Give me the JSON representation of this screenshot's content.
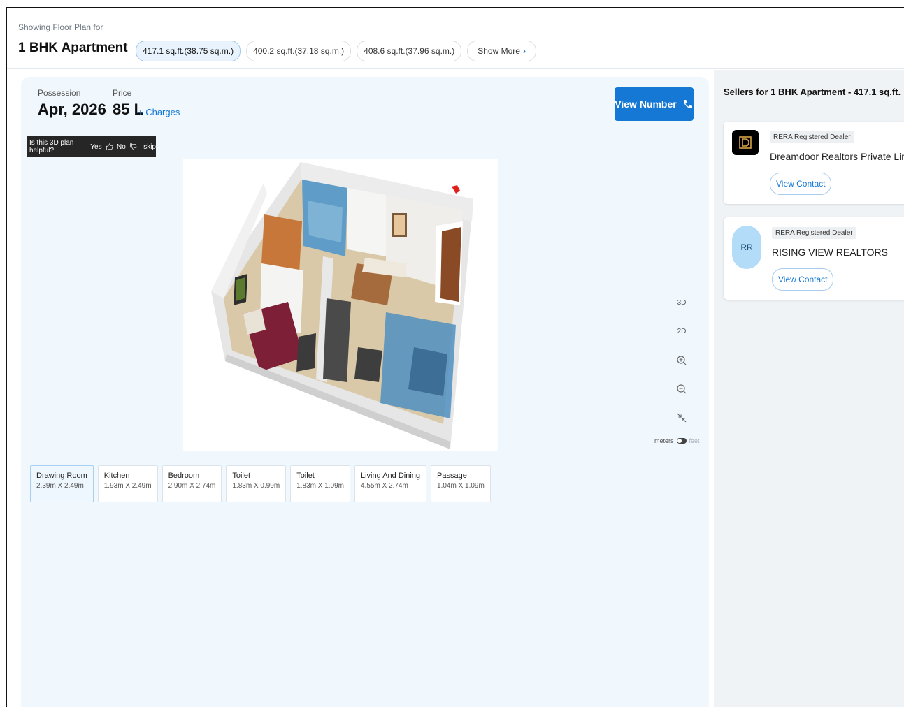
{
  "header": {
    "showing_label": "Showing Floor Plan for",
    "configuration": "1 BHK Apartment",
    "size_options": [
      "417.1 sq.ft.(38.75 sq.m.)",
      "400.2 sq.ft.(37.18 sq.m.)",
      "408.6 sq.ft.(37.96 sq.m.)"
    ],
    "show_more_label": "Show More",
    "show_more_arrow": "›"
  },
  "summary": {
    "possession_label": "Possession",
    "possession_value": "Apr, 2026",
    "price_label": "Price",
    "price_value": "85 L",
    "charges_link": "+ Charges",
    "view_number_label": "View Number"
  },
  "feedback": {
    "question": "Is this 3D plan helpful?",
    "yes": "Yes",
    "no": "No",
    "skip": "skip"
  },
  "viewer_tools": {
    "view_3d": "3D",
    "view_2d": "2D",
    "unit_meters": "meters",
    "unit_feet": "feet"
  },
  "rooms": [
    {
      "name": "Drawing Room",
      "dims": "2.39m X 2.49m"
    },
    {
      "name": "Kitchen",
      "dims": "1.93m X 2.49m"
    },
    {
      "name": "Bedroom",
      "dims": "2.90m X 2.74m"
    },
    {
      "name": "Toilet",
      "dims": "1.83m X 0.99m"
    },
    {
      "name": "Toilet",
      "dims": "1.83m X 1.09m"
    },
    {
      "name": "Living And Dining",
      "dims": "4.55m X 2.74m"
    },
    {
      "name": "Passage",
      "dims": "1.04m X 1.09m"
    }
  ],
  "sellers": {
    "title": "Sellers for 1 BHK Apartment - 417.1 sq.ft.",
    "items": [
      {
        "badge": "RERA Registered Dealer",
        "name": "Dreamdoor Realtors Private Limited",
        "contact_label": "View Contact"
      },
      {
        "badge": "RERA Registered Dealer",
        "name": "RISING VIEW REALTORS",
        "initials": "RR",
        "contact_label": "View Contact"
      }
    ]
  },
  "colors": {
    "accent": "#1478d4",
    "panel_bg": "#f0f7fd",
    "side_bg": "#f0f3f6"
  }
}
